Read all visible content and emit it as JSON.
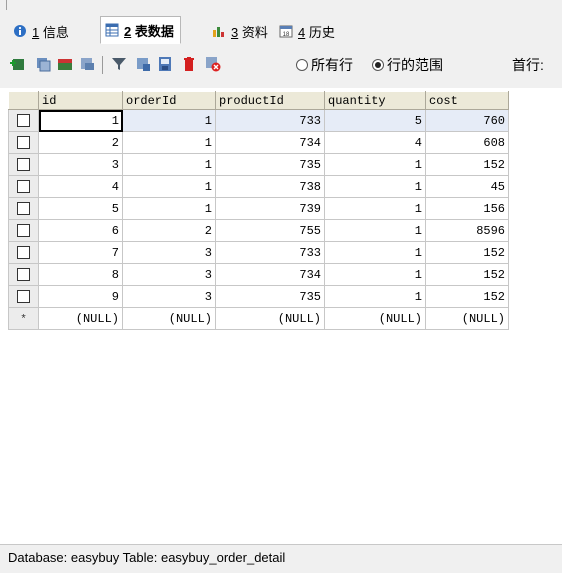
{
  "tabs": [
    {
      "key": "1",
      "label": "信息",
      "icon": "info-icon"
    },
    {
      "key": "2",
      "label": "表数据",
      "icon": "table-icon"
    },
    {
      "key": "3",
      "label": "资料",
      "icon": "info-chart-icon"
    },
    {
      "key": "4",
      "label": "历史",
      "icon": "calendar-icon"
    }
  ],
  "toolbar": {
    "radio_all": "所有行",
    "radio_range": "行的范围",
    "radio_selected": "range",
    "first_row_label": "首行:"
  },
  "table": {
    "columns": [
      "id",
      "orderId",
      "productId",
      "quantity",
      "cost"
    ],
    "rows": [
      [
        "1",
        "1",
        "733",
        "5",
        "760"
      ],
      [
        "2",
        "1",
        "734",
        "4",
        "608"
      ],
      [
        "3",
        "1",
        "735",
        "1",
        "152"
      ],
      [
        "4",
        "1",
        "738",
        "1",
        "45"
      ],
      [
        "5",
        "1",
        "739",
        "1",
        "156"
      ],
      [
        "6",
        "2",
        "755",
        "1",
        "8596"
      ],
      [
        "7",
        "3",
        "733",
        "1",
        "152"
      ],
      [
        "8",
        "3",
        "734",
        "1",
        "152"
      ],
      [
        "9",
        "3",
        "735",
        "1",
        "152"
      ]
    ],
    "new_row": [
      "(NULL)",
      "(NULL)",
      "(NULL)",
      "(NULL)",
      "(NULL)"
    ],
    "new_row_marker": "*"
  },
  "status": {
    "text": "Database: easybuy  Table: easybuy_order_detail"
  }
}
